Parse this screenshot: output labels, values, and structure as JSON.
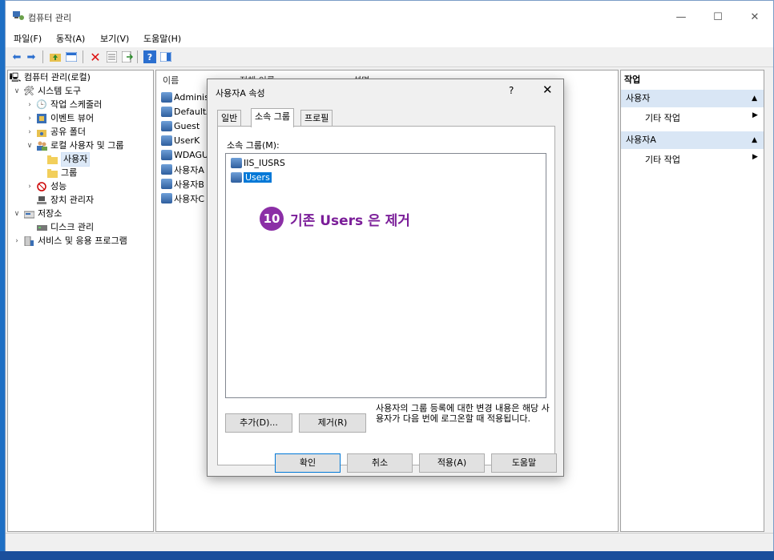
{
  "window": {
    "title": "컴퓨터 관리",
    "controls": [
      "—",
      "☐",
      "✕"
    ]
  },
  "menu": [
    "파일(F)",
    "동작(A)",
    "보기(V)",
    "도움말(H)"
  ],
  "tree": {
    "items": [
      {
        "label": "컴퓨터 관리(로컬)",
        "icon": "computer-management-icon"
      },
      {
        "label": "시스템 도구",
        "icon": "tools-icon"
      },
      {
        "label": "작업 스케줄러",
        "icon": "clock-icon"
      },
      {
        "label": "이벤트 뷰어",
        "icon": "event-viewer-icon"
      },
      {
        "label": "공유 폴더",
        "icon": "shared-folder-icon"
      },
      {
        "label": "로컬 사용자 및 그룹",
        "icon": "users-icon"
      },
      {
        "label": "사용자",
        "icon": "folder-icon"
      },
      {
        "label": "그룹",
        "icon": "folder-icon"
      },
      {
        "label": "성능",
        "icon": "performance-icon"
      },
      {
        "label": "장치 관리자",
        "icon": "device-manager-icon"
      },
      {
        "label": "저장소",
        "icon": "storage-icon"
      },
      {
        "label": "디스크 관리",
        "icon": "disk-icon"
      },
      {
        "label": "서비스 및 응용 프로그램",
        "icon": "services-icon"
      }
    ]
  },
  "list": {
    "columns": [
      "이름",
      "전체 이름",
      "설명"
    ],
    "rows": [
      "Adminis",
      "DefaultA",
      "Guest",
      "UserK",
      "WDAGU",
      "사용자A",
      "사용자B",
      "사용자C"
    ]
  },
  "actions": {
    "header": "작업",
    "groups": [
      {
        "title": "사용자",
        "item": "기타 작업"
      },
      {
        "title": "사용자A",
        "item": "기타 작업"
      }
    ]
  },
  "dialog": {
    "title": "사용자A 속성",
    "help": "?",
    "close": "✕",
    "tabs": [
      "일반",
      "소속 그룹",
      "프로필"
    ],
    "active_tab": "소속 그룹",
    "member_of_label": "소속 그룹(M):",
    "groups": [
      "IIS_IUSRS",
      "Users"
    ],
    "selected_group": "Users",
    "add_button": "추가(D)...",
    "remove_button": "제거(R)",
    "note": "사용자의 그룹 등록에 대한 변경 내용은 해당 사용자가 다음 번에 로그온할 때 적용됩니다.",
    "ok": "확인",
    "cancel": "취소",
    "apply": "적용(A)",
    "helpbtn": "도움말"
  },
  "annotation": {
    "number": "10",
    "text": "기존 Users 은 제거",
    "color": "#8b2fa6"
  }
}
